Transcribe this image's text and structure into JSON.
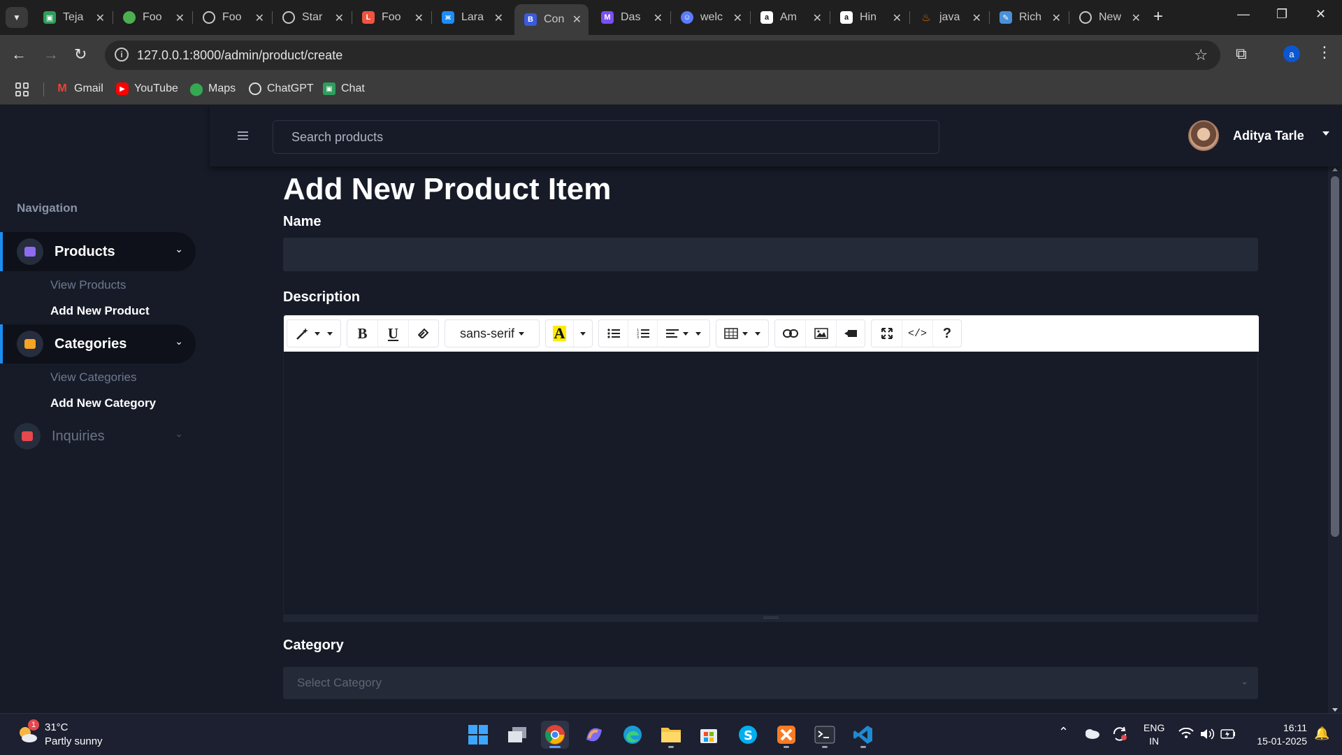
{
  "browser": {
    "tabs": [
      {
        "label": "Teja",
        "icon": "google-chat-icon",
        "color": "#2e9e5b"
      },
      {
        "label": "Foo",
        "icon": "leaf-icon",
        "color": "#4caf50"
      },
      {
        "label": "Foo",
        "icon": "globe-icon",
        "color": "#9e9e9e"
      },
      {
        "label": "Star",
        "icon": "globe-icon",
        "color": "#9e9e9e"
      },
      {
        "label": "Foo",
        "icon": "laravel-icon",
        "color": "#f05340"
      },
      {
        "label": "Lara",
        "icon": "butterfly-icon",
        "color": "#1d8cf8"
      },
      {
        "label": "Con",
        "icon": "bootstrap-icon",
        "color": "#3b5bdb"
      },
      {
        "label": "Das",
        "icon": "dashboard-icon",
        "color": "#7b4ff0"
      },
      {
        "label": "welc",
        "icon": "ai-icon",
        "color": "#5b7cfa"
      },
      {
        "label": "Am",
        "icon": "amazon-icon",
        "color": "#ffffff"
      },
      {
        "label": "Hin",
        "icon": "amazon-icon",
        "color": "#ffffff"
      },
      {
        "label": "java",
        "icon": "java-icon",
        "color": "#e76f00"
      },
      {
        "label": "Rich",
        "icon": "notepad-icon",
        "color": "#4a90d9"
      },
      {
        "label": "New",
        "icon": "chrome-icon",
        "color": "#9e9e9e"
      }
    ],
    "url": "127.0.0.1:8000/admin/product/create",
    "profile_initial": "a",
    "bookmarks": [
      {
        "label": "Gmail",
        "icon": "gmail-icon",
        "color": "#ea4335"
      },
      {
        "label": "YouTube",
        "icon": "youtube-icon",
        "color": "#ff0000"
      },
      {
        "label": "Maps",
        "icon": "maps-icon",
        "color": "#34a853"
      },
      {
        "label": "ChatGPT",
        "icon": "chatgpt-icon",
        "color": "#dddddd"
      },
      {
        "label": "Chat",
        "icon": "google-chat-icon",
        "color": "#2e9e5b"
      }
    ]
  },
  "sidebar": {
    "heading": "Navigation",
    "items": [
      {
        "label": "Products",
        "icon_color": "#8e6cf0",
        "sub": [
          "View Products",
          "Add New Product"
        ]
      },
      {
        "label": "Categories",
        "icon_color": "#f5a524",
        "sub": [
          "View Categories",
          "Add New Category"
        ]
      },
      {
        "label": "Inquiries",
        "icon_color": "#e5484d",
        "sub": []
      }
    ]
  },
  "header": {
    "search_placeholder": "Search products",
    "user_name": "Aditya Tarle"
  },
  "form": {
    "title": "Add New Product Item",
    "name_label": "Name",
    "description_label": "Description",
    "font_name": "sans-serif",
    "category_label": "Category",
    "category_placeholder": "Select Category"
  },
  "taskbar": {
    "weather_temp": "31°C",
    "weather_desc": "Partly sunny",
    "weather_badge": "1",
    "lang_line1": "ENG",
    "lang_line2": "IN",
    "time": "16:11",
    "date": "15-01-2025"
  }
}
